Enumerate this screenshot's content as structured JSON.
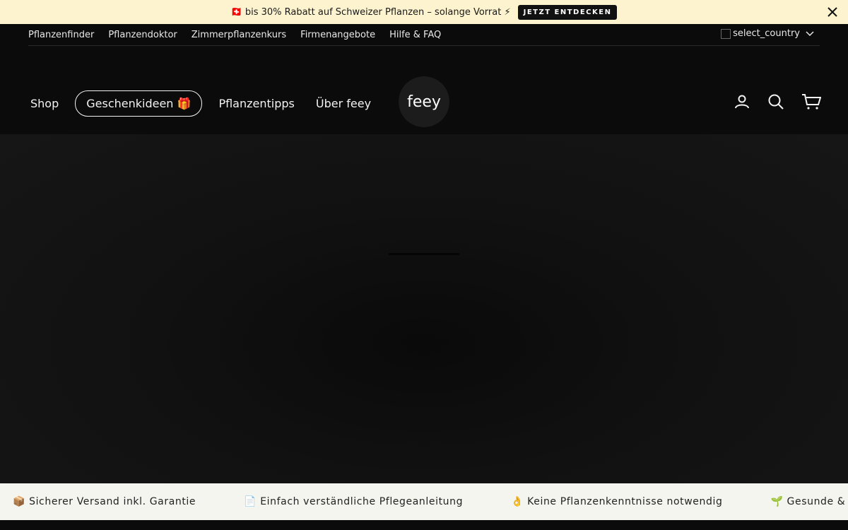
{
  "announcement": {
    "text": "🇨🇭 bis 30% Rabatt auf Schweizer Pflanzen – solange Vorrat ⚡",
    "cta_label": "JETZT ENTDECKEN",
    "close_icon": "close-icon"
  },
  "utility_nav": {
    "items": [
      "Pflanzenfinder",
      "Pflanzendoktor",
      "Zimmerpflanzenkurs",
      "Firmenangebote",
      "Hilfe & FAQ"
    ],
    "country_alt": "select_country",
    "country_icon": "chevron-down-icon"
  },
  "main_nav": {
    "items": [
      "Shop",
      "Geschenkideen 🎁",
      "Pflanzentipps",
      "Über feey"
    ]
  },
  "logo": {
    "text": "feey"
  },
  "header_icons": [
    "user-icon",
    "search-icon",
    "cart-icon"
  ],
  "trust_bar": {
    "items": [
      "📦 Sicherer Versand inkl. Garantie",
      "📄 Einfach verständliche Pflegeanleitung",
      "👌 Keine Pflanzenkenntnisse notwendig",
      "🌱 Gesunde & langle"
    ]
  },
  "colors": {
    "announcement_bg": "#fdf3cf",
    "page_bg": "#0b0b0b",
    "trust_bg": "#f5f5ef"
  }
}
